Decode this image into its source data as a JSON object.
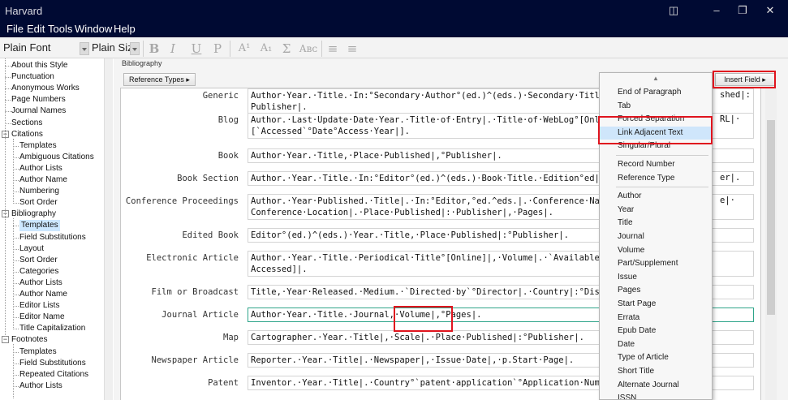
{
  "window": {
    "title": "Harvard",
    "controls": {
      "minimize": "–",
      "restore": "❐",
      "close": "✕"
    }
  },
  "menu": [
    "File",
    "Edit",
    "Tools",
    "Window",
    "Help"
  ],
  "toolbar": {
    "font": "Plain Font",
    "size": "Plain Size",
    "buttons": {
      "bold": "B",
      "italic": "I",
      "underline": "U",
      "plain": "P",
      "superscript": "A¹",
      "subscript": "A₁",
      "symbol": "Σ",
      "smallcaps": "Aʙᴄ"
    }
  },
  "sidebar": {
    "items": [
      {
        "label": "About this Style",
        "level": 1
      },
      {
        "label": "Punctuation",
        "level": 1
      },
      {
        "label": "Anonymous Works",
        "level": 1
      },
      {
        "label": "Page Numbers",
        "level": 1
      },
      {
        "label": "Journal Names",
        "level": 1
      },
      {
        "label": "Sections",
        "level": 1
      },
      {
        "label": "Citations",
        "level": 0
      },
      {
        "label": "Templates",
        "level": 2
      },
      {
        "label": "Ambiguous Citations",
        "level": 2
      },
      {
        "label": "Author Lists",
        "level": 2
      },
      {
        "label": "Author Name",
        "level": 2
      },
      {
        "label": "Numbering",
        "level": 2
      },
      {
        "label": "Sort Order",
        "level": 2
      },
      {
        "label": "Bibliography",
        "level": 0
      },
      {
        "label": "Templates",
        "level": 2,
        "selected": true
      },
      {
        "label": "Field Substitutions",
        "level": 2
      },
      {
        "label": "Layout",
        "level": 2
      },
      {
        "label": "Sort Order",
        "level": 2
      },
      {
        "label": "Categories",
        "level": 2
      },
      {
        "label": "Author Lists",
        "level": 2
      },
      {
        "label": "Author Name",
        "level": 2
      },
      {
        "label": "Editor Lists",
        "level": 2
      },
      {
        "label": "Editor Name",
        "level": 2
      },
      {
        "label": "Title Capitalization",
        "level": 2
      },
      {
        "label": "Footnotes",
        "level": 0
      },
      {
        "label": "Templates",
        "level": 2
      },
      {
        "label": "Field Substitutions",
        "level": 2
      },
      {
        "label": "Repeated Citations",
        "level": 2
      },
      {
        "label": "Author Lists",
        "level": 2
      }
    ]
  },
  "panel": {
    "title": "Bibliography",
    "reference_types_button": "Reference Types ▸",
    "insert_field_button": "Insert Field ▸"
  },
  "templates": [
    {
      "label": "Generic",
      "lines": [
        "Author·Year.·Title.·In:°Secondary·Author°(ed.)^(eds.)·Secondary·Title.·",
        "Publisher|."
      ],
      "tail": "shed|:"
    },
    {
      "label": "Blog",
      "lines": [
        "Author.·Last·Update·Date·Year.·Title·of·Entry|.·Title·of·WebLog°[Online",
        "[`Accessed`°Date°Access·Year|]."
      ],
      "tail": "RL|·"
    },
    {
      "label": "Book",
      "lines": [
        "Author·Year.·Title,·Place·Published|,°Publisher|."
      ]
    },
    {
      "label": "Book Section",
      "lines": [
        "Author.·Year.·Title.·In:°Editor°(ed.)^(eds.)·Book·Title.·Edition°ed|.·Pl"
      ],
      "tail": "er|."
    },
    {
      "label": "Conference Proceedings",
      "lines": [
        "Author.·Year·Published.·Title|.·In:°Editor,°ed.^eds.|.·Conference·Name|,",
        "Conference·Location|.·Place·Published|:·Publisher|,·Pages|."
      ],
      "tail": "e|·"
    },
    {
      "label": "Edited Book",
      "lines": [
        "Editor°(ed.)^(eds.)·Year.·Title,·Place·Published|:°Publisher|."
      ]
    },
    {
      "label": "Electronic Article",
      "lines": [
        "Author.·Year.·Title.·Periodical·Title°[Online]|,·Volume|.·`Available:`°",
        "Accessed]|."
      ]
    },
    {
      "label": "Film or Broadcast",
      "lines": [
        "Title,·Year·Released.·Medium.·`Directed·by`°Director|.·Country|:°Distri"
      ]
    },
    {
      "label": "Journal Article",
      "lines": [
        "Author·Year.·Title.·Journal,·Volume|,°Pages|."
      ],
      "active": true
    },
    {
      "label": "Map",
      "lines": [
        "Cartographer.·Year.·Title|,·Scale|.·Place·Published|:°Publisher|."
      ]
    },
    {
      "label": "Newspaper Article",
      "lines": [
        "Reporter.·Year.·Title|.·Newspaper|,·Issue·Date|,·p.Start·Page|."
      ]
    },
    {
      "label": "Patent",
      "lines": [
        "Inventor.·Year.·Title|.·Country°`patent·application`°Application·Number"
      ]
    }
  ],
  "field_menu": {
    "scroll_up": "▲",
    "items": [
      "End of Paragraph",
      "Tab",
      "Forced Separation",
      "Link Adjacent Text",
      "Singular/Plural",
      "",
      "Record Number",
      "Reference Type",
      "",
      "Author",
      "Year",
      "Title",
      "Journal",
      "Volume",
      "Part/Supplement",
      "Issue",
      "Pages",
      "Start Page",
      "Errata",
      "Epub Date",
      "Date",
      "Type of Article",
      "Short Title",
      "Alternate Journal",
      "ISSN"
    ],
    "highlighted": "Link Adjacent Text"
  },
  "colors": {
    "titlebar": "#000a33",
    "highlight": "#cfe6fb",
    "annotation": "#e0141e",
    "active_border": "#2fa58a"
  }
}
